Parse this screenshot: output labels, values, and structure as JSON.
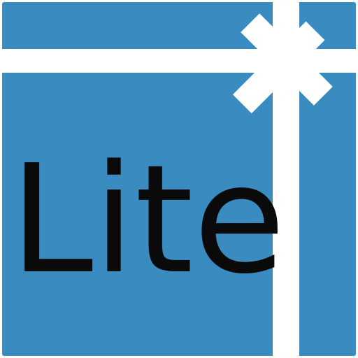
{
  "app_icon": {
    "label": "Lite",
    "colors": {
      "box": "#3A8BC0",
      "ribbon": "#FFFFFF",
      "text": "#0A0A0A"
    },
    "icons": {
      "ribbon": "ribbon-icon",
      "bow": "bow-icon"
    }
  }
}
